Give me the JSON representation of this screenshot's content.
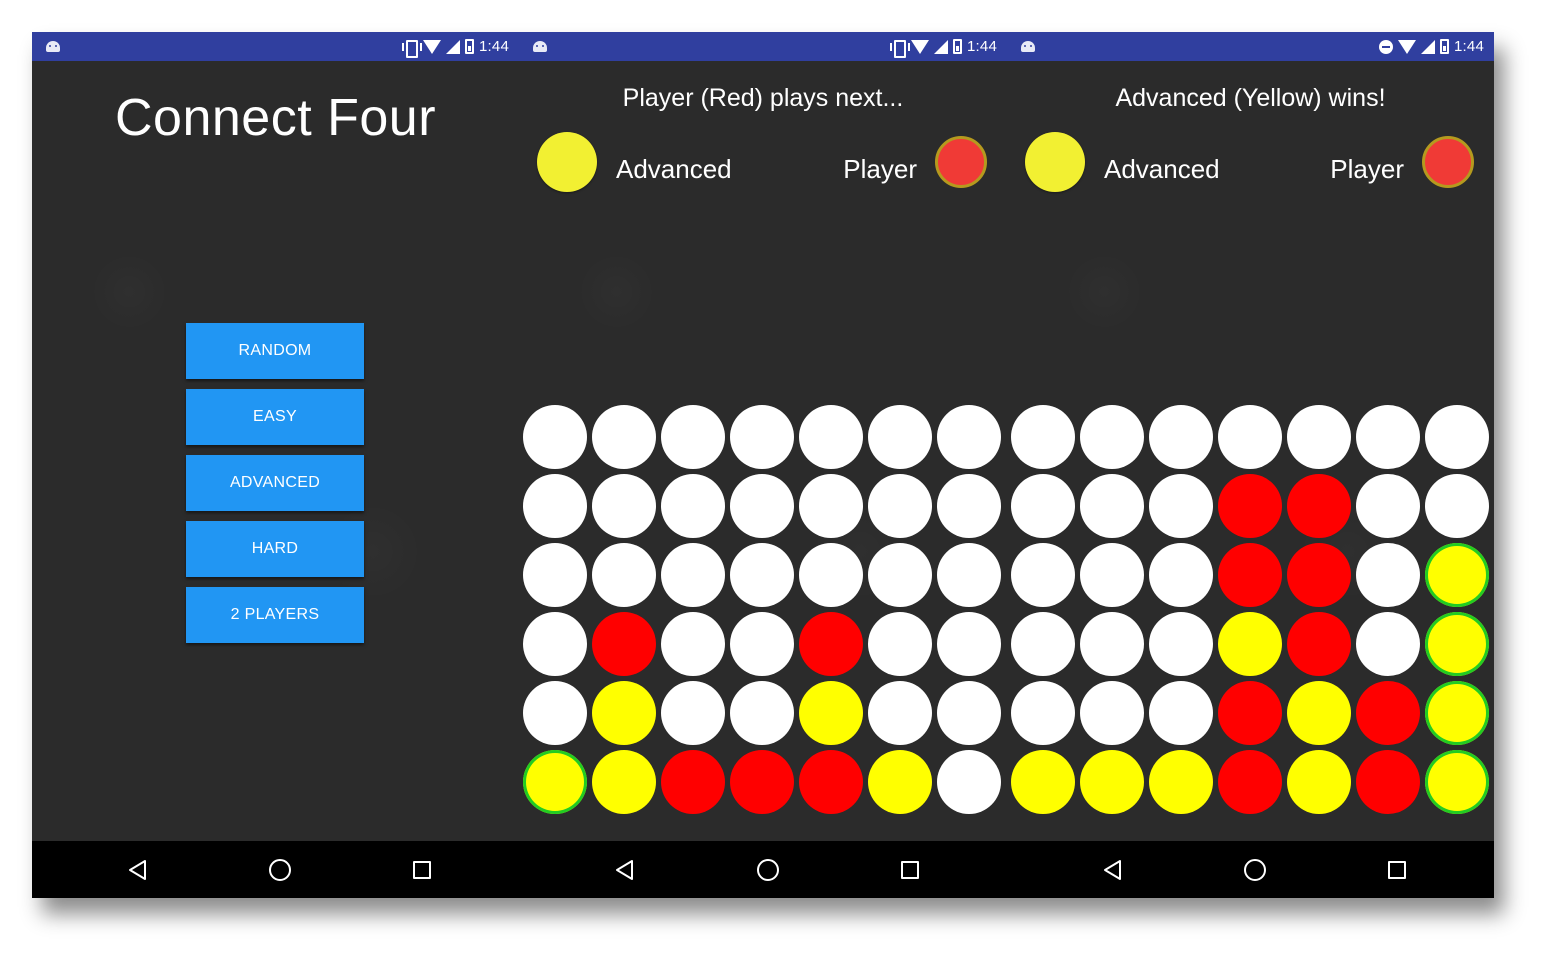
{
  "status_bar": {
    "time": "1:44"
  },
  "menu_screen": {
    "title": "Connect Four",
    "buttons": [
      "RANDOM",
      "EASY",
      "ADVANCED",
      "HARD",
      "2 PLAYERS"
    ]
  },
  "game_screens": [
    {
      "status": "Player (Red) plays next...",
      "left_player": "Advanced",
      "right_player": "Player",
      "board": [
        [
          "E",
          "E",
          "E",
          "E",
          "E",
          "E",
          "E"
        ],
        [
          "E",
          "E",
          "E",
          "E",
          "E",
          "E",
          "E"
        ],
        [
          "E",
          "E",
          "E",
          "E",
          "E",
          "E",
          "E"
        ],
        [
          "E",
          "R",
          "E",
          "E",
          "R",
          "E",
          "E"
        ],
        [
          "E",
          "Y",
          "E",
          "E",
          "Y",
          "E",
          "E"
        ],
        [
          "W",
          "Y",
          "R",
          "R",
          "R",
          "Y",
          "E"
        ]
      ]
    },
    {
      "status": "Advanced (Yellow) wins!",
      "left_player": "Advanced",
      "right_player": "Player",
      "board": [
        [
          "E",
          "E",
          "E",
          "E",
          "E",
          "E",
          "E"
        ],
        [
          "E",
          "E",
          "E",
          "R",
          "R",
          "E",
          "E"
        ],
        [
          "E",
          "E",
          "E",
          "R",
          "R",
          "E",
          "W"
        ],
        [
          "E",
          "E",
          "E",
          "Y",
          "R",
          "E",
          "W"
        ],
        [
          "E",
          "E",
          "E",
          "R",
          "Y",
          "R",
          "W"
        ],
        [
          "Y",
          "Y",
          "Y",
          "R",
          "Y",
          "R",
          "W"
        ]
      ]
    }
  ],
  "colors": {
    "status_bar": "#303f9f",
    "button": "#2196f3",
    "red_disc": "#ff0000",
    "yellow_disc": "#ffff00",
    "win_outline": "#22cc22",
    "background": "#2b2b2b"
  }
}
